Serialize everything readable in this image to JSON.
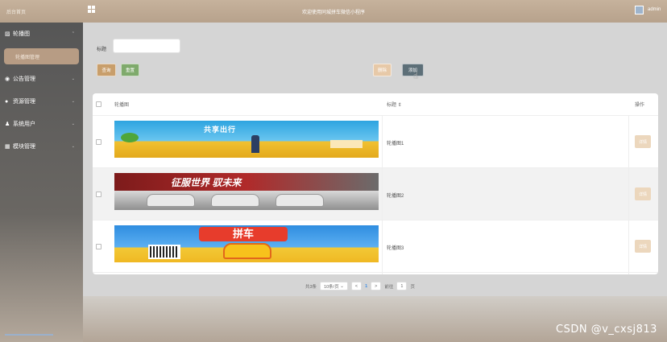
{
  "app": {
    "home_label": "后台首页",
    "title": "欢迎使用同城拼车微信小程序",
    "user": "admin"
  },
  "sidebar": {
    "items": [
      {
        "icon": "image-icon",
        "glyph": "▨",
        "label": "轮播图",
        "arrow": "⌃"
      },
      {
        "icon": "notice-icon",
        "glyph": "◉",
        "label": "公告管理",
        "arrow": "⌄"
      },
      {
        "icon": "resource-icon",
        "glyph": "●",
        "label": "资源管理",
        "arrow": "⌄"
      },
      {
        "icon": "user-icon",
        "glyph": "♟",
        "label": "系统用户",
        "arrow": "⌄"
      },
      {
        "icon": "module-icon",
        "glyph": "▦",
        "label": "模块管理",
        "arrow": "⌄"
      }
    ],
    "active_sub": "轮播图管理"
  },
  "search": {
    "label": "标题",
    "value": "",
    "placeholder": ""
  },
  "buttons": {
    "query": "查询",
    "reset": "重置",
    "delete": "删除",
    "add": "添加"
  },
  "table": {
    "headers": {
      "image": "轮播图",
      "title": "标题 ⇕",
      "op": "操作"
    },
    "rows": [
      {
        "title": "轮播图1",
        "detail": "详情",
        "banner_text": "共享出行"
      },
      {
        "title": "轮播图2",
        "detail": "详情",
        "banner_text": "征服世界 驭未来"
      },
      {
        "title": "轮播图3",
        "detail": "详情",
        "banner_text": "拼车"
      }
    ]
  },
  "pager": {
    "total": "共3条",
    "page_size": "10条/页",
    "prev": "<",
    "current": "1",
    "next": ">",
    "goto_label": "前往",
    "goto_value": "1",
    "page_suffix": "页"
  },
  "watermark": "CSDN @v_cxsj813",
  "colors": {
    "topbar": "#b7a28c",
    "sidebar": "#565656",
    "query": "#c89e6b",
    "reset": "#7faa6c",
    "delete": "#e7c9a8",
    "add": "#5d6f78"
  }
}
